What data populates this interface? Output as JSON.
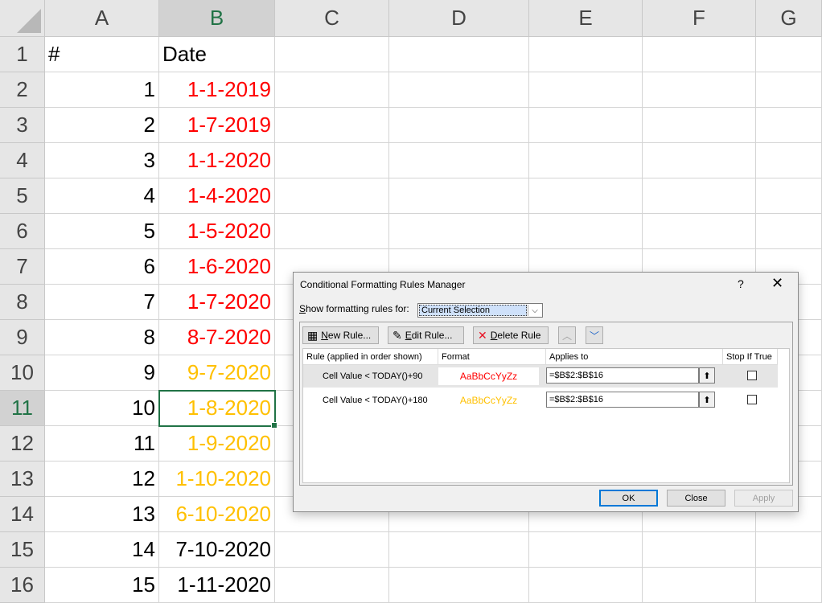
{
  "columns": [
    "A",
    "B",
    "C",
    "D",
    "E",
    "F",
    "G"
  ],
  "rows": [
    {
      "num": "1",
      "a": "#",
      "b": "Date",
      "b_color": "#000000",
      "a_align": "l"
    },
    {
      "num": "2",
      "a": "1",
      "b": "1-1-2019",
      "b_color": "#ff0000"
    },
    {
      "num": "3",
      "a": "2",
      "b": "1-7-2019",
      "b_color": "#ff0000"
    },
    {
      "num": "4",
      "a": "3",
      "b": "1-1-2020",
      "b_color": "#ff0000"
    },
    {
      "num": "5",
      "a": "4",
      "b": "1-4-2020",
      "b_color": "#ff0000"
    },
    {
      "num": "6",
      "a": "5",
      "b": "1-5-2020",
      "b_color": "#ff0000"
    },
    {
      "num": "7",
      "a": "6",
      "b": "1-6-2020",
      "b_color": "#ff0000"
    },
    {
      "num": "8",
      "a": "7",
      "b": "1-7-2020",
      "b_color": "#ff0000"
    },
    {
      "num": "9",
      "a": "8",
      "b": "8-7-2020",
      "b_color": "#ff0000"
    },
    {
      "num": "10",
      "a": "9",
      "b": "9-7-2020",
      "b_color": "#ffc000"
    },
    {
      "num": "11",
      "a": "10",
      "b": "1-8-2020",
      "b_color": "#ffc000"
    },
    {
      "num": "12",
      "a": "11",
      "b": "1-9-2020",
      "b_color": "#ffc000"
    },
    {
      "num": "13",
      "a": "12",
      "b": "1-10-2020",
      "b_color": "#ffc000"
    },
    {
      "num": "14",
      "a": "13",
      "b": "6-10-2020",
      "b_color": "#ffc000"
    },
    {
      "num": "15",
      "a": "14",
      "b": "7-10-2020",
      "b_color": "#000000"
    },
    {
      "num": "16",
      "a": "15",
      "b": "1-11-2020",
      "b_color": "#000000"
    }
  ],
  "active_cell": {
    "column": "B",
    "row": "11"
  },
  "dialog": {
    "title": "Conditional Formatting Rules Manager",
    "help": "?",
    "close_glyph": "✕",
    "show_label_pre": "",
    "show_label_u": "S",
    "show_label_post": "how formatting rules for:",
    "show_value": "Current Selection",
    "toolbar": {
      "new_u": "N",
      "new_rest": "ew Rule...",
      "edit_u": "E",
      "edit_rest": "dit Rule...",
      "delete_u": "D",
      "delete_rest": "elete Rule"
    },
    "headers": {
      "rule": "Rule (applied in order shown)",
      "format": "Format",
      "applies": "Applies to",
      "stop": "Stop If True"
    },
    "rules": [
      {
        "rule": "Cell Value < TODAY()+90",
        "preview": "AaBbCcYyZz",
        "preview_color": "#ff0000",
        "applies_to": "=$B$2:$B$16",
        "stop_if_true": false
      },
      {
        "rule": "Cell Value < TODAY()+180",
        "preview": "AaBbCcYyZz",
        "preview_color": "#ffc000",
        "applies_to": "=$B$2:$B$16",
        "stop_if_true": false
      }
    ],
    "buttons": {
      "ok": "OK",
      "close": "Close",
      "apply": "Apply"
    }
  },
  "colors": {
    "excel_green": "#217346",
    "header_bg": "#e6e6e6",
    "red": "#ff0000",
    "amber": "#ffc000"
  }
}
